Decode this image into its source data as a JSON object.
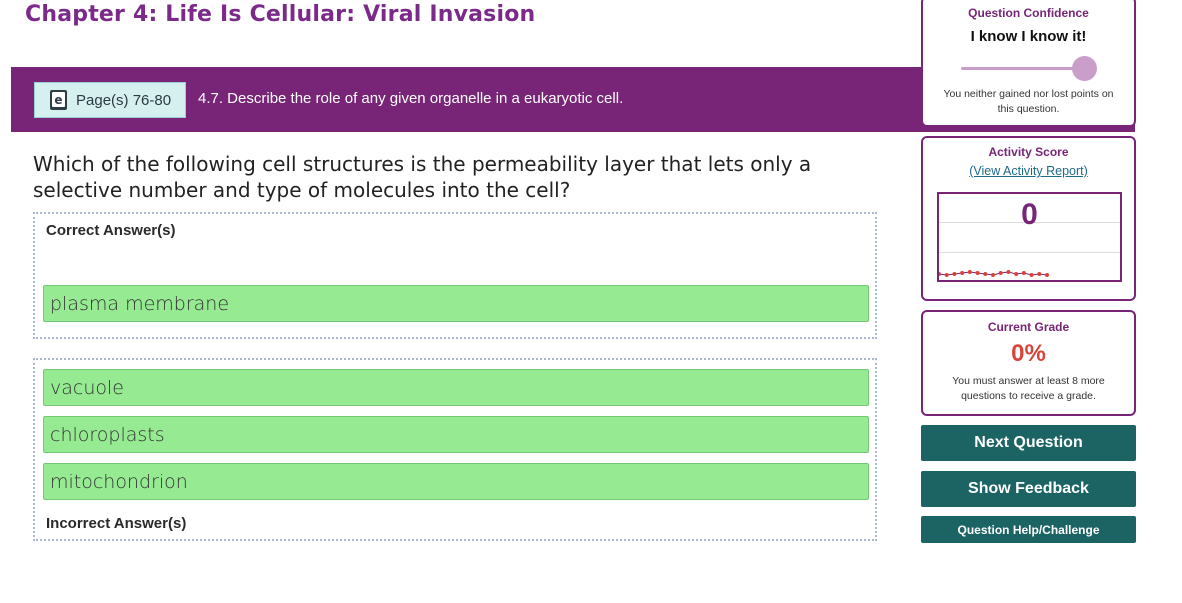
{
  "chapter_title": "Chapter 4: Life Is Cellular: Viral Invasion",
  "objective_bar": {
    "pages_label": "Page(s) 76-80",
    "objective": "4.7. Describe the role of any given organelle in a eukaryotic cell.",
    "ebook_icon": "ebook-icon",
    "bar_color": "#782577"
  },
  "question": {
    "text": "Which of the following cell structures is the permeability layer that lets only a selective number and type of molecules into the cell?",
    "correct_label": "Correct Answer(s)",
    "incorrect_label": "Incorrect Answer(s)",
    "correct_answers": [
      "plasma membrane"
    ],
    "incorrect_answers": [
      "vacuole",
      "chloroplasts",
      "mitochondrion"
    ]
  },
  "confidence": {
    "title": "Question Confidence",
    "value": "I know I know it!",
    "note": "You neither gained nor lost points on this question.",
    "slider_level": 1.0
  },
  "activity": {
    "title": "Activity Score",
    "link": "(View Activity Report)",
    "score": "0",
    "score_history": [
      0,
      0,
      0,
      0,
      0,
      0,
      0,
      0,
      0,
      0,
      0,
      0,
      0,
      0,
      0
    ]
  },
  "grade": {
    "title": "Current Grade",
    "value": "0%",
    "note": "You must answer at least 8 more questions to receive a grade."
  },
  "buttons": {
    "next": "Next Question",
    "feedback": "Show Feedback",
    "help": "Question Help/Challenge"
  },
  "colors": {
    "purple": "#782577",
    "teal": "#1c6464",
    "answer_green": "#95ea92",
    "grade_red": "#d9443a"
  }
}
